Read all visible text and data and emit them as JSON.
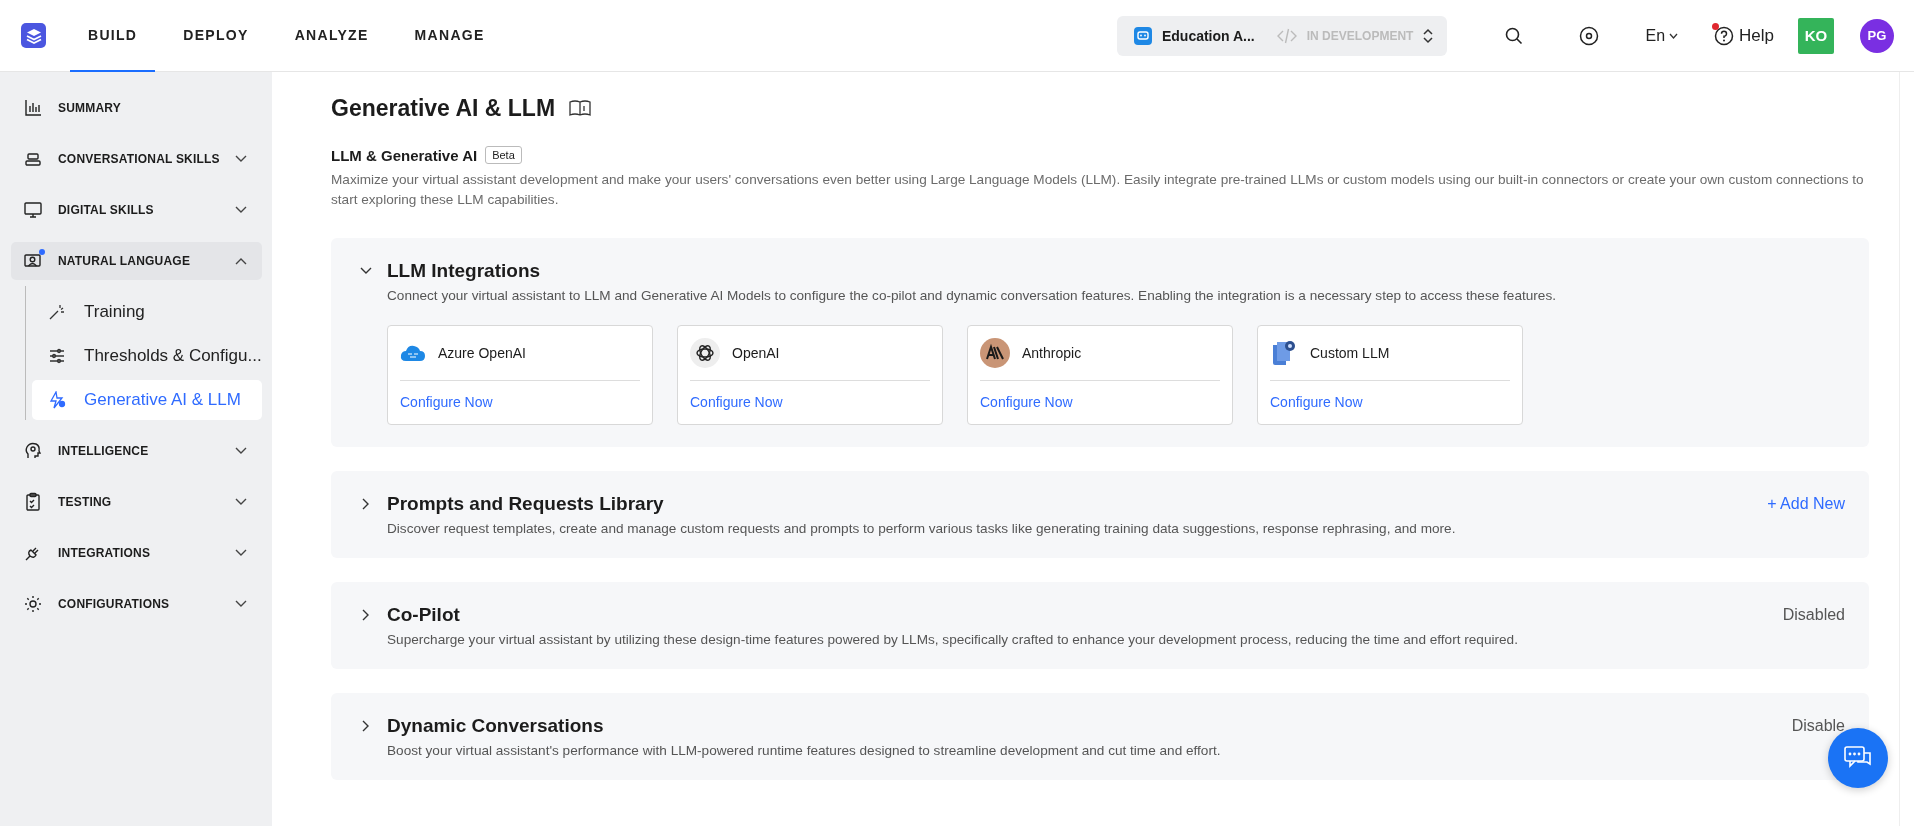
{
  "nav": {
    "tabs": [
      {
        "label": "BUILD",
        "selected": true
      },
      {
        "label": "DEPLOY",
        "selected": false
      },
      {
        "label": "ANALYZE",
        "selected": false
      },
      {
        "label": "MANAGE",
        "selected": false
      }
    ]
  },
  "app_switcher": {
    "name": "Education A...",
    "status": "IN DEVELOPMENT"
  },
  "language": "En",
  "help": {
    "label": "Help",
    "notification": true
  },
  "users": [
    {
      "initials": "KO",
      "color": "#34b45a",
      "kind": "square"
    },
    {
      "initials": "PG",
      "color": "#7a2fe2",
      "kind": "circle"
    }
  ],
  "sidebar": {
    "items": [
      {
        "label": "SUMMARY",
        "kind": "link",
        "expanded": false,
        "notification": false
      },
      {
        "label": "CONVERSATIONAL SKILLS",
        "kind": "group",
        "expanded": false,
        "notification": false
      },
      {
        "label": "DIGITAL SKILLS",
        "kind": "group",
        "expanded": false,
        "notification": false
      },
      {
        "label": "NATURAL LANGUAGE",
        "kind": "group",
        "expanded": true,
        "notification": true,
        "children": [
          {
            "label": "Training",
            "selected": false
          },
          {
            "label": "Thresholds & Configu...",
            "selected": false
          },
          {
            "label": "Generative AI & LLM",
            "selected": true
          }
        ]
      },
      {
        "label": "INTELLIGENCE",
        "kind": "group",
        "expanded": false,
        "notification": false
      },
      {
        "label": "TESTING",
        "kind": "group",
        "expanded": false,
        "notification": false
      },
      {
        "label": "INTEGRATIONS",
        "kind": "group",
        "expanded": false,
        "notification": false
      },
      {
        "label": "CONFIGURATIONS",
        "kind": "group",
        "expanded": false,
        "notification": false
      }
    ]
  },
  "page": {
    "title": "Generative AI & LLM",
    "subtitle": "LLM & Generative AI",
    "badge": "Beta",
    "description": "Maximize your virtual assistant development and make your users' conversations even better using Large Language Models (LLM). Easily integrate pre-trained LLMs or custom models using our built-in connectors or create your own custom connections to start exploring these LLM capabilities."
  },
  "sections": [
    {
      "title": "LLM Integrations",
      "expanded": true,
      "description": "Connect your virtual assistant to LLM and Generative AI Models to configure the co-pilot and dynamic conversation features. Enabling the integration is a necessary step to access these features.",
      "cards": [
        {
          "name": "Azure OpenAI",
          "link": "Configure Now"
        },
        {
          "name": "OpenAI",
          "link": "Configure Now"
        },
        {
          "name": "Anthropic",
          "link": "Configure Now"
        },
        {
          "name": "Custom LLM",
          "link": "Configure Now"
        }
      ]
    },
    {
      "title": "Prompts and Requests Library",
      "expanded": false,
      "description": "Discover request templates, create and manage custom requests and prompts to perform various tasks like generating training data suggestions, response rephrasing, and more.",
      "action": "+ Add New"
    },
    {
      "title": "Co-Pilot",
      "expanded": false,
      "description": "Supercharge your virtual assistant by utilizing these design-time features powered by LLMs, specifically crafted to enhance your development process, reducing the time and effort required.",
      "status": "Disabled"
    },
    {
      "title": "Dynamic Conversations",
      "expanded": false,
      "description": "Boost your virtual assistant's performance with LLM-powered runtime features designed to streamline development and cut time and effort.",
      "status": "Disable"
    }
  ]
}
